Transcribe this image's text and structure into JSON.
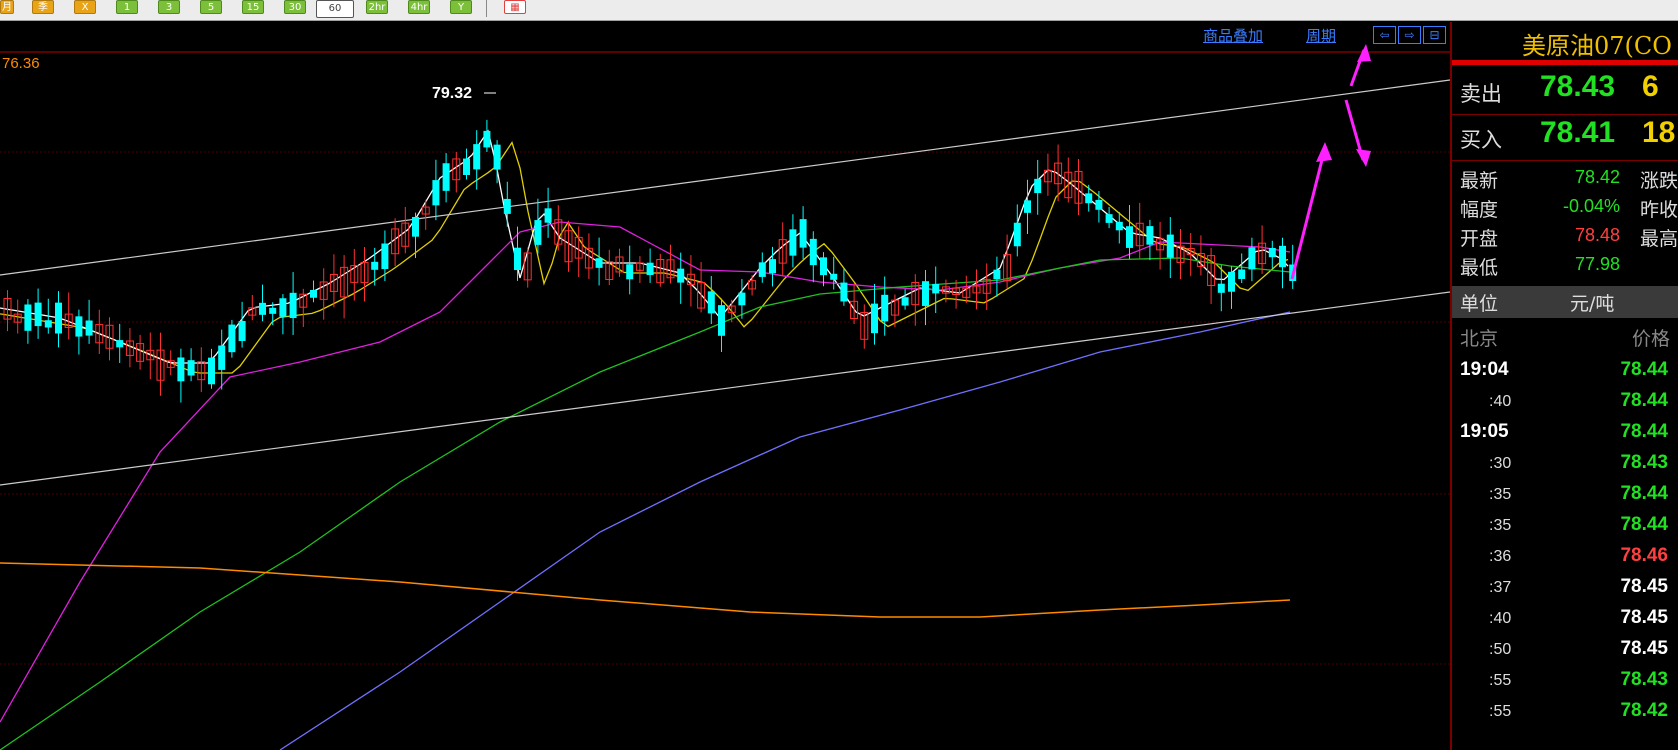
{
  "toolbar": {
    "buttons": [
      {
        "label": "月",
        "style": "yel"
      },
      {
        "label": "季",
        "style": "yel"
      },
      {
        "label": "Χ",
        "style": "yel"
      },
      {
        "label": "1",
        "style": "grn"
      },
      {
        "label": "3",
        "style": "grn"
      },
      {
        "label": "5",
        "style": "grn"
      },
      {
        "label": "15",
        "style": "grn"
      },
      {
        "label": "30",
        "style": "grn"
      },
      {
        "label": "60",
        "style": "sel"
      },
      {
        "label": "2hr",
        "style": "grn"
      },
      {
        "label": "4hr",
        "style": "grn"
      },
      {
        "label": "Y",
        "style": "grn"
      },
      {
        "label": "▦",
        "style": "red"
      }
    ]
  },
  "chart_header": {
    "overlay_link": "商品叠加",
    "period_link": "周期",
    "nav_icons": [
      "arrow-left-icon",
      "arrow-right-icon",
      "layout-icon"
    ]
  },
  "chart_data": {
    "type": "candlestick",
    "ylim": [
      71.7,
      77.2
    ],
    "annotations": {
      "axis_top_label": "76.36",
      "high_label": "79.32"
    },
    "colors": {
      "up": "#ff3030",
      "down": "#00ffff",
      "ma_white": "#ffffff",
      "ma_yellow": "#e0d000",
      "ma_magenta": "#e020e0",
      "ma_green": "#20c020",
      "ma_blue": "#7070ff",
      "ma_orange": "#ff8a00",
      "trend": "#cccccc",
      "arrow": "#ff20ff"
    }
  },
  "panel": {
    "title": "美原油07(CO",
    "ask": {
      "label": "卖出",
      "price": "78.43",
      "volume": "6"
    },
    "bid": {
      "label": "买入",
      "price": "78.41",
      "volume": "18"
    },
    "stats": [
      {
        "label": "最新",
        "value": "78.42",
        "color": "#22e022",
        "label2": "涨跌"
      },
      {
        "label": "幅度",
        "value": "-0.04%",
        "color": "#22e022",
        "label2": "昨收"
      },
      {
        "label": "开盘",
        "value": "78.48",
        "color": "#ff4040",
        "label2": "最高"
      },
      {
        "label": "最低",
        "value": "77.98",
        "color": "#22e022",
        "label2": ""
      }
    ],
    "unit": {
      "label": "单位",
      "value": "元/吨"
    },
    "ticks_header": {
      "left": "北京",
      "right": "价格"
    },
    "ticks": [
      {
        "time": "19:04",
        "full": true,
        "price": "78.44",
        "color": "#22e022"
      },
      {
        "time": ":40",
        "full": false,
        "price": "78.44",
        "color": "#22e022"
      },
      {
        "time": "19:05",
        "full": true,
        "price": "78.44",
        "color": "#22e022"
      },
      {
        "time": ":30",
        "full": false,
        "price": "78.43",
        "color": "#22e022"
      },
      {
        "time": ":35",
        "full": false,
        "price": "78.44",
        "color": "#22e022"
      },
      {
        "time": ":35",
        "full": false,
        "price": "78.44",
        "color": "#22e022"
      },
      {
        "time": ":36",
        "full": false,
        "price": "78.46",
        "color": "#ff4040"
      },
      {
        "time": ":37",
        "full": false,
        "price": "78.45",
        "color": "#ffffff"
      },
      {
        "time": ":40",
        "full": false,
        "price": "78.45",
        "color": "#ffffff"
      },
      {
        "time": ":50",
        "full": false,
        "price": "78.45",
        "color": "#ffffff"
      },
      {
        "time": ":55",
        "full": false,
        "price": "78.43",
        "color": "#22e022"
      },
      {
        "time": ":55",
        "full": false,
        "price": "78.42",
        "color": "#22e022"
      }
    ]
  }
}
